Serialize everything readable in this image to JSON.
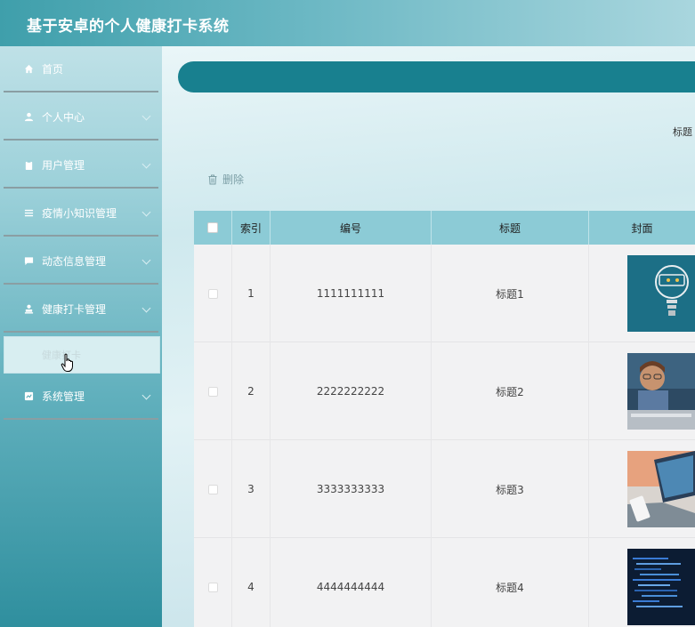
{
  "header": {
    "title": "基于安卓的个人健康打卡系统"
  },
  "sidebar": {
    "items": [
      {
        "label": "首页",
        "icon": "home-icon",
        "expandable": false
      },
      {
        "label": "个人中心",
        "icon": "user-icon",
        "expandable": true
      },
      {
        "label": "用户管理",
        "icon": "clipboard-icon",
        "expandable": true
      },
      {
        "label": "疫情小知识管理",
        "icon": "list-icon",
        "expandable": true
      },
      {
        "label": "动态信息管理",
        "icon": "message-icon",
        "expandable": true
      },
      {
        "label": "健康打卡管理",
        "icon": "person-icon",
        "expandable": true
      },
      {
        "label": "系统管理",
        "icon": "chart-icon",
        "expandable": true
      }
    ],
    "submenu_active": {
      "label": "健康打卡"
    }
  },
  "toolbar": {
    "delete_label": "删除",
    "search_label": "标题"
  },
  "table": {
    "columns": [
      "索引",
      "编号",
      "标题",
      "封面"
    ],
    "rows": [
      {
        "index": "1",
        "number": "1111111111",
        "title": "标题1",
        "cover": "idea-bulb-image"
      },
      {
        "index": "2",
        "number": "2222222222",
        "title": "标题2",
        "cover": "child-keyboard-image"
      },
      {
        "index": "3",
        "number": "3333333333",
        "title": "标题3",
        "cover": "laptop-phone-image"
      },
      {
        "index": "4",
        "number": "4444444444",
        "title": "标题4",
        "cover": "code-screen-image"
      }
    ]
  },
  "colors": {
    "accent": "#18808f",
    "header_start": "#3f9fab",
    "table_header": "#8ccbd6"
  }
}
